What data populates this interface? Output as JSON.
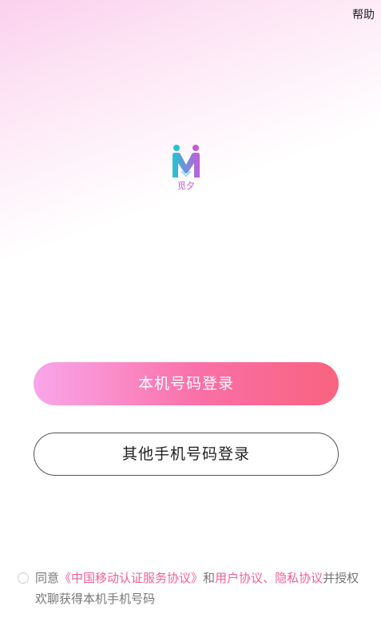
{
  "header": {
    "help_label": "帮助"
  },
  "logo": {
    "caption": "觅夕",
    "icon": "app-logo-icon"
  },
  "buttons": {
    "local_login": "本机号码登录",
    "other_login": "其他手机号码登录"
  },
  "agreement": {
    "prefix": "同意",
    "cmcc_agreement": "《中国移动认证服务协议》",
    "and": "和",
    "user_agreement": "用户协议",
    "separator": "、",
    "privacy_agreement": "隐私协议",
    "suffix": "并授权欢聊获得本机手机号码"
  },
  "colors": {
    "accent": "#f96380",
    "link": "#f0609a",
    "logo_teal": "#22c4d4",
    "logo_purple": "#c45bd8"
  }
}
